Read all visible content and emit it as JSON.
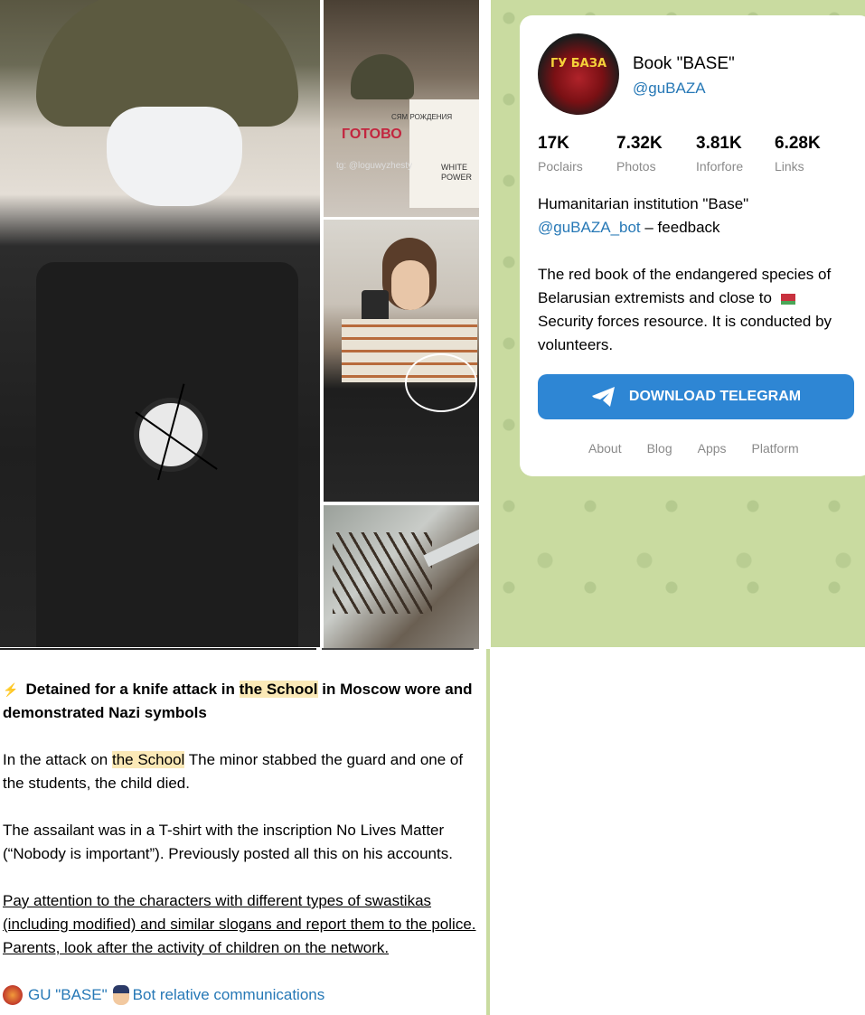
{
  "collage": {
    "photo_top_caption": "СЯМ РОЖДЕНИЯ",
    "photo_top_sign": "ГОТОВО",
    "photo_top_handle": "tg: @loguwyzhesty",
    "photo_top_sign2": "WHITE POWER"
  },
  "channel": {
    "avatar_text": "ГУ БАЗА",
    "title": "Book \"BASE\"",
    "handle": "@guBAZA",
    "stats": [
      {
        "value": "17K",
        "label": "Poclairs"
      },
      {
        "value": "7.32K",
        "label": "Photos"
      },
      {
        "value": "3.81K",
        "label": "Inforfore"
      },
      {
        "value": "6.28K",
        "label": "Links"
      }
    ],
    "desc_line1": "Humanitarian institution \"Base\"",
    "desc_bot_link": "@guBAZA_bot",
    "desc_feedback": " – feedback",
    "desc_para2a": "The red book of the endangered species of Belarusian extremists and close to ",
    "desc_para2b": " Security forces resource. It is conducted by volunteers.",
    "download_label": "DOWNLOAD TELEGRAM",
    "footer": [
      "About",
      "Blog",
      "Apps",
      "Platform"
    ]
  },
  "post": {
    "headline_pre": "Detained for a knife attack in ",
    "headline_hl": "the School",
    "headline_post": " in Moscow wore and demonstrated Nazi symbols",
    "p2_pre": "In the attack on ",
    "p2_hl": "the School",
    "p2_post": " The minor stabbed the guard and one of the students, the child died.",
    "p3": "The assailant was in a T-shirt with the inscription No Lives Matter (“Nobody is important”). Previously posted all this on his accounts.",
    "p4": "Pay attention to the characters with different types of swastikas (including modified) and similar slogans and report them to the police. Parents, look after the activity of children on the network.",
    "sig_channel": "GU \"BASE\"",
    "sig_bot": "Bot relative communications"
  },
  "colors": {
    "link": "#2678b6",
    "button": "#2e86d4",
    "highlight": "#fbe9b7",
    "panel_bg": "#c9dba0"
  }
}
